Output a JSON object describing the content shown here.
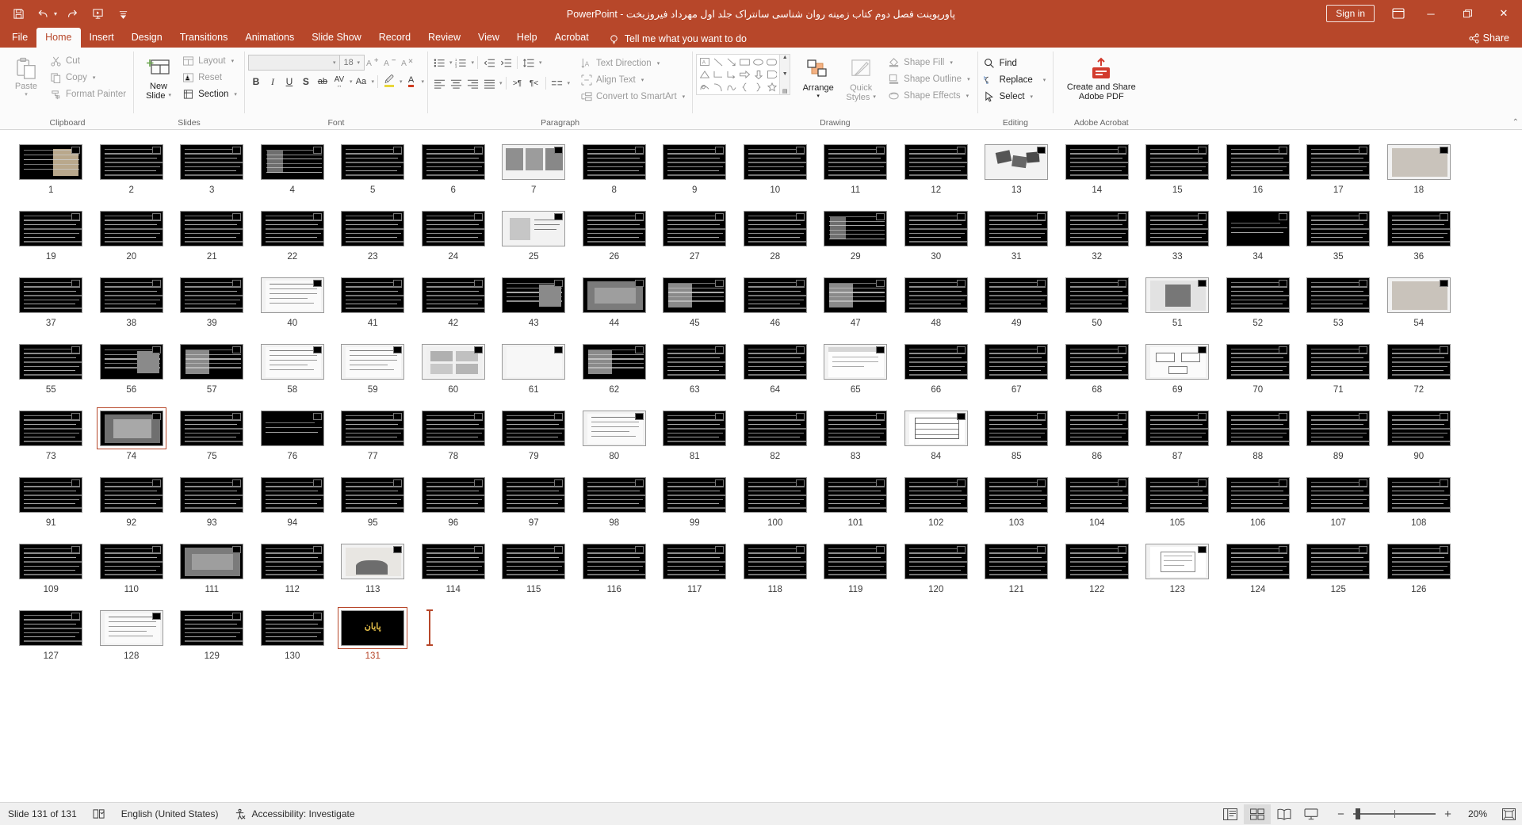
{
  "app": {
    "title": "پاورپوینت فصل دوم کتاب زمینه روان شناسی سانتراک جلد اول مهرداد فیروزبخت  -  PowerPoint",
    "sign_in": "Sign in",
    "accent_color": "#b7472a"
  },
  "quick_access": {
    "items": [
      {
        "name": "save-icon",
        "label": "Save"
      },
      {
        "name": "undo-icon",
        "label": "Undo"
      },
      {
        "name": "redo-icon",
        "label": "Redo"
      },
      {
        "name": "start-presentation-icon",
        "label": "Start From Beginning"
      },
      {
        "name": "customize-qat-icon",
        "label": "Customize Quick Access Toolbar"
      }
    ]
  },
  "window_controls": {
    "minimize": "─",
    "restore": "❐",
    "close": "✕",
    "ribbon_display": "Ribbon Display Options"
  },
  "tabs": [
    {
      "label": "File",
      "active": false
    },
    {
      "label": "Home",
      "active": true
    },
    {
      "label": "Insert",
      "active": false
    },
    {
      "label": "Design",
      "active": false
    },
    {
      "label": "Transitions",
      "active": false
    },
    {
      "label": "Animations",
      "active": false
    },
    {
      "label": "Slide Show",
      "active": false
    },
    {
      "label": "Record",
      "active": false
    },
    {
      "label": "Review",
      "active": false
    },
    {
      "label": "View",
      "active": false
    },
    {
      "label": "Help",
      "active": false
    },
    {
      "label": "Acrobat",
      "active": false
    }
  ],
  "tell_me": {
    "placeholder": "Tell me what you want to do"
  },
  "share": {
    "label": "Share"
  },
  "ribbon": {
    "clipboard": {
      "label": "Clipboard",
      "paste": "Paste",
      "cut": "Cut",
      "copy": "Copy",
      "format_painter": "Format Painter"
    },
    "slides": {
      "label": "Slides",
      "new_slide": "New\nSlide",
      "new_slide_line1": "New",
      "new_slide_line2": "Slide",
      "layout": "Layout",
      "reset": "Reset",
      "section": "Section"
    },
    "font": {
      "label": "Font",
      "font_name": "",
      "font_size": "18",
      "bold": "B",
      "italic": "I",
      "underline": "U",
      "shadow": "S",
      "strikethrough": "ab",
      "char_spacing": "AV",
      "change_case": "Aa",
      "text_highlight": "A",
      "font_color": "A",
      "increase_size": "A",
      "decrease_size": "A",
      "clear_formatting": "A"
    },
    "paragraph": {
      "label": "Paragraph",
      "text_direction": "Text Direction",
      "align_text": "Align Text",
      "convert_to_smartart": "Convert to SmartArt"
    },
    "drawing": {
      "label": "Drawing",
      "arrange": "Arrange",
      "quick_styles_line1": "Quick",
      "quick_styles_line2": "Styles",
      "shape_fill": "Shape Fill",
      "shape_outline": "Shape Outline",
      "shape_effects": "Shape Effects"
    },
    "editing": {
      "label": "Editing",
      "find": "Find",
      "replace": "Replace",
      "select": "Select"
    },
    "acrobat": {
      "label": "Adobe Acrobat",
      "create_share_line1": "Create and Share",
      "create_share_line2": "Adobe PDF"
    }
  },
  "slides": {
    "total": 131,
    "selected": 131,
    "items": [
      {
        "n": 1,
        "style": "image-left"
      },
      {
        "n": 2,
        "style": "text"
      },
      {
        "n": 3,
        "style": "text"
      },
      {
        "n": 4,
        "style": "image-left-small"
      },
      {
        "n": 5,
        "style": "text"
      },
      {
        "n": 6,
        "style": "text"
      },
      {
        "n": 7,
        "style": "light-images"
      },
      {
        "n": 8,
        "style": "text"
      },
      {
        "n": 9,
        "style": "text"
      },
      {
        "n": 10,
        "style": "text"
      },
      {
        "n": 11,
        "style": "text"
      },
      {
        "n": 12,
        "style": "text"
      },
      {
        "n": 13,
        "style": "light-diagram"
      },
      {
        "n": 14,
        "style": "text"
      },
      {
        "n": 15,
        "style": "text"
      },
      {
        "n": 16,
        "style": "text"
      },
      {
        "n": 17,
        "style": "text"
      },
      {
        "n": 18,
        "style": "light-photo"
      },
      {
        "n": 19,
        "style": "text"
      },
      {
        "n": 20,
        "style": "text"
      },
      {
        "n": 21,
        "style": "text"
      },
      {
        "n": 22,
        "style": "text"
      },
      {
        "n": 23,
        "style": "text"
      },
      {
        "n": 24,
        "style": "text"
      },
      {
        "n": 25,
        "style": "light-chart"
      },
      {
        "n": 26,
        "style": "text"
      },
      {
        "n": 27,
        "style": "text"
      },
      {
        "n": 28,
        "style": "text"
      },
      {
        "n": 29,
        "style": "image-left-small"
      },
      {
        "n": 30,
        "style": "text"
      },
      {
        "n": 31,
        "style": "text"
      },
      {
        "n": 32,
        "style": "text"
      },
      {
        "n": 33,
        "style": "text"
      },
      {
        "n": 34,
        "style": "dark-plain"
      },
      {
        "n": 35,
        "style": "text"
      },
      {
        "n": 36,
        "style": "text"
      },
      {
        "n": 37,
        "style": "text"
      },
      {
        "n": 38,
        "style": "text"
      },
      {
        "n": 39,
        "style": "text"
      },
      {
        "n": 40,
        "style": "light-doc"
      },
      {
        "n": 41,
        "style": "text"
      },
      {
        "n": 42,
        "style": "text"
      },
      {
        "n": 43,
        "style": "photo-right"
      },
      {
        "n": 44,
        "style": "photo-wide"
      },
      {
        "n": 45,
        "style": "photo-left"
      },
      {
        "n": 46,
        "style": "text"
      },
      {
        "n": 47,
        "style": "photo-left"
      },
      {
        "n": 48,
        "style": "text"
      },
      {
        "n": 49,
        "style": "text"
      },
      {
        "n": 50,
        "style": "text"
      },
      {
        "n": 51,
        "style": "photo-center"
      },
      {
        "n": 52,
        "style": "text"
      },
      {
        "n": 53,
        "style": "text"
      },
      {
        "n": 54,
        "style": "light-photo"
      },
      {
        "n": 55,
        "style": "text"
      },
      {
        "n": 56,
        "style": "photo-right"
      },
      {
        "n": 57,
        "style": "photo-left"
      },
      {
        "n": 58,
        "style": "light-doc"
      },
      {
        "n": 59,
        "style": "light-doc"
      },
      {
        "n": 60,
        "style": "light-grid"
      },
      {
        "n": 61,
        "style": "light-plain"
      },
      {
        "n": 62,
        "style": "photo-left"
      },
      {
        "n": 63,
        "style": "text"
      },
      {
        "n": 64,
        "style": "text"
      },
      {
        "n": 65,
        "style": "light-window"
      },
      {
        "n": 66,
        "style": "text"
      },
      {
        "n": 67,
        "style": "text"
      },
      {
        "n": 68,
        "style": "text"
      },
      {
        "n": 69,
        "style": "light-diagram2"
      },
      {
        "n": 70,
        "style": "text"
      },
      {
        "n": 71,
        "style": "text"
      },
      {
        "n": 72,
        "style": "text"
      },
      {
        "n": 73,
        "style": "text"
      },
      {
        "n": 74,
        "style": "photo-wide-sel"
      },
      {
        "n": 75,
        "style": "text"
      },
      {
        "n": 76,
        "style": "dark-plain"
      },
      {
        "n": 77,
        "style": "text"
      },
      {
        "n": 78,
        "style": "text"
      },
      {
        "n": 79,
        "style": "text"
      },
      {
        "n": 80,
        "style": "light-doc"
      },
      {
        "n": 81,
        "style": "text"
      },
      {
        "n": 82,
        "style": "text"
      },
      {
        "n": 83,
        "style": "text"
      },
      {
        "n": 84,
        "style": "light-table"
      },
      {
        "n": 85,
        "style": "text"
      },
      {
        "n": 86,
        "style": "text"
      },
      {
        "n": 87,
        "style": "text"
      },
      {
        "n": 88,
        "style": "text"
      },
      {
        "n": 89,
        "style": "text"
      },
      {
        "n": 90,
        "style": "text"
      },
      {
        "n": 91,
        "style": "text"
      },
      {
        "n": 92,
        "style": "text"
      },
      {
        "n": 93,
        "style": "text"
      },
      {
        "n": 94,
        "style": "text"
      },
      {
        "n": 95,
        "style": "text"
      },
      {
        "n": 96,
        "style": "text"
      },
      {
        "n": 97,
        "style": "text"
      },
      {
        "n": 98,
        "style": "text"
      },
      {
        "n": 99,
        "style": "text"
      },
      {
        "n": 100,
        "style": "text"
      },
      {
        "n": 101,
        "style": "text"
      },
      {
        "n": 102,
        "style": "text"
      },
      {
        "n": 103,
        "style": "text"
      },
      {
        "n": 104,
        "style": "text"
      },
      {
        "n": 105,
        "style": "text"
      },
      {
        "n": 106,
        "style": "text"
      },
      {
        "n": 107,
        "style": "text"
      },
      {
        "n": 108,
        "style": "text"
      },
      {
        "n": 109,
        "style": "text"
      },
      {
        "n": 110,
        "style": "text"
      },
      {
        "n": 111,
        "style": "photo-wide"
      },
      {
        "n": 112,
        "style": "text"
      },
      {
        "n": 113,
        "style": "light-photo2"
      },
      {
        "n": 114,
        "style": "text"
      },
      {
        "n": 115,
        "style": "text"
      },
      {
        "n": 116,
        "style": "text"
      },
      {
        "n": 117,
        "style": "text"
      },
      {
        "n": 118,
        "style": "text"
      },
      {
        "n": 119,
        "style": "text"
      },
      {
        "n": 120,
        "style": "text"
      },
      {
        "n": 121,
        "style": "text"
      },
      {
        "n": 122,
        "style": "text"
      },
      {
        "n": 123,
        "style": "light-doc2"
      },
      {
        "n": 124,
        "style": "text"
      },
      {
        "n": 125,
        "style": "text"
      },
      {
        "n": 126,
        "style": "text"
      },
      {
        "n": 127,
        "style": "text"
      },
      {
        "n": 128,
        "style": "light-doc"
      },
      {
        "n": 129,
        "style": "text"
      },
      {
        "n": 130,
        "style": "text"
      },
      {
        "n": 131,
        "style": "end-slide",
        "text": "پایان"
      }
    ]
  },
  "status_bar": {
    "slide_counter": "Slide 131 of 131",
    "notes_icon": "notes-icon",
    "language": "English (United States)",
    "accessibility": "Accessibility: Investigate",
    "views": [
      {
        "name": "normal-view-button",
        "label": "Normal",
        "active": false
      },
      {
        "name": "slide-sorter-view-button",
        "label": "Slide Sorter",
        "active": true
      },
      {
        "name": "reading-view-button",
        "label": "Reading View",
        "active": false
      },
      {
        "name": "slide-show-button",
        "label": "Slide Show",
        "active": false
      }
    ],
    "zoom_out": "−",
    "zoom_in": "+",
    "zoom_level": "20%",
    "fit_to_window": "Fit slide to current window"
  }
}
